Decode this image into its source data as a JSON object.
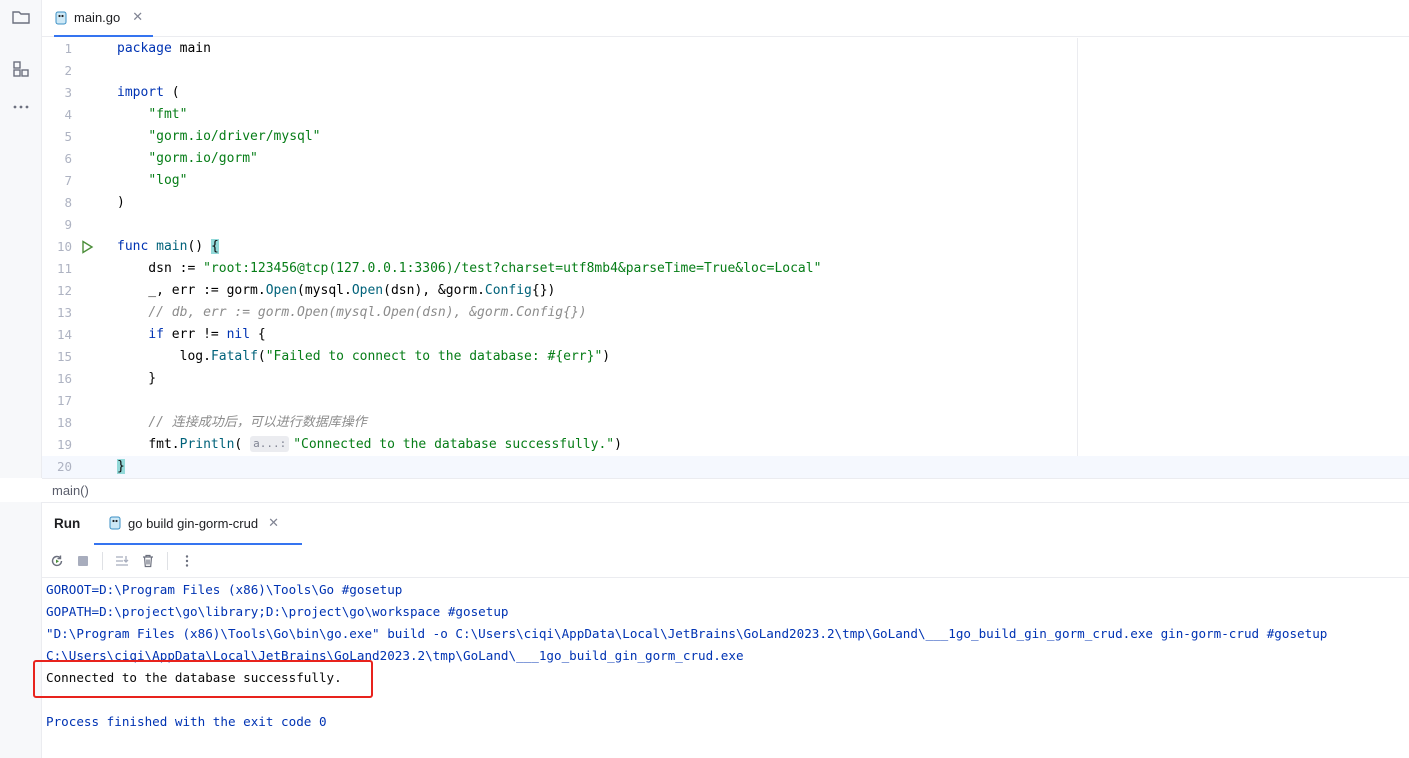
{
  "tabs": [
    {
      "label": "main.go",
      "active": true
    }
  ],
  "editor": {
    "lines": [
      {
        "n": "1",
        "tokens": [
          [
            "kw",
            "package"
          ],
          [
            "pkg",
            " main"
          ]
        ]
      },
      {
        "n": "2",
        "tokens": []
      },
      {
        "n": "3",
        "tokens": [
          [
            "kw",
            "import"
          ],
          [
            "pkg",
            " ("
          ]
        ]
      },
      {
        "n": "4",
        "tokens": [
          [
            "pkg",
            "    "
          ],
          [
            "str",
            "\"fmt\""
          ]
        ]
      },
      {
        "n": "5",
        "tokens": [
          [
            "pkg",
            "    "
          ],
          [
            "str",
            "\"gorm.io/driver/mysql\""
          ]
        ]
      },
      {
        "n": "6",
        "tokens": [
          [
            "pkg",
            "    "
          ],
          [
            "str",
            "\"gorm.io/gorm\""
          ]
        ]
      },
      {
        "n": "7",
        "tokens": [
          [
            "pkg",
            "    "
          ],
          [
            "str",
            "\"log\""
          ]
        ]
      },
      {
        "n": "8",
        "tokens": [
          [
            "pkg",
            ")"
          ]
        ]
      },
      {
        "n": "9",
        "tokens": []
      },
      {
        "n": "10",
        "run": true,
        "tokens": [
          [
            "kw",
            "func"
          ],
          [
            "pkg",
            " "
          ],
          [
            "fn",
            "main"
          ],
          [
            "pkg",
            "() "
          ],
          [
            "hl",
            "{"
          ]
        ]
      },
      {
        "n": "11",
        "tokens": [
          [
            "pkg",
            "    dsn := "
          ],
          [
            "str",
            "\"root:123456@tcp(127.0.0.1:3306)/test?charset=utf8mb4&parseTime=True&loc=Local\""
          ]
        ]
      },
      {
        "n": "12",
        "tokens": [
          [
            "pkg",
            "    _, err := "
          ],
          [
            "pkg",
            "gorm"
          ],
          [
            "pkg",
            "."
          ],
          [
            "fn",
            "Open"
          ],
          [
            "pkg",
            "("
          ],
          [
            "pkg",
            "mysql"
          ],
          [
            "pkg",
            "."
          ],
          [
            "fn",
            "Open"
          ],
          [
            "pkg",
            "(dsn), &"
          ],
          [
            "pkg",
            "gorm"
          ],
          [
            "pkg",
            "."
          ],
          [
            "typ",
            "Config"
          ],
          [
            "pkg",
            "{})"
          ]
        ]
      },
      {
        "n": "13",
        "tokens": [
          [
            "pkg",
            "    "
          ],
          [
            "cm",
            "// db, err := gorm.Open(mysql.Open(dsn), &gorm.Config{})"
          ]
        ]
      },
      {
        "n": "14",
        "tokens": [
          [
            "pkg",
            "    "
          ],
          [
            "kw",
            "if"
          ],
          [
            "pkg",
            " err != "
          ],
          [
            "kw",
            "nil"
          ],
          [
            "pkg",
            " {"
          ]
        ]
      },
      {
        "n": "15",
        "tokens": [
          [
            "pkg",
            "        "
          ],
          [
            "pkg",
            "log"
          ],
          [
            "pkg",
            "."
          ],
          [
            "fn",
            "Fatalf"
          ],
          [
            "pkg",
            "("
          ],
          [
            "str",
            "\"Failed to connect to the database: #{err}\""
          ],
          [
            "pkg",
            ")"
          ]
        ]
      },
      {
        "n": "16",
        "tokens": [
          [
            "pkg",
            "    }"
          ]
        ]
      },
      {
        "n": "17",
        "tokens": []
      },
      {
        "n": "18",
        "tokens": [
          [
            "pkg",
            "    "
          ],
          [
            "cm",
            "// 连接成功后，可以进行数据库操作"
          ]
        ]
      },
      {
        "n": "19",
        "tokens": [
          [
            "pkg",
            "    "
          ],
          [
            "pkg",
            "fmt"
          ],
          [
            "pkg",
            "."
          ],
          [
            "fn",
            "Println"
          ],
          [
            "pkg",
            "( "
          ],
          [
            "hint",
            "a...:"
          ],
          [
            "str",
            "\"Connected to the database successfully.\""
          ],
          [
            "pkg",
            ")"
          ]
        ]
      },
      {
        "n": "20",
        "current": true,
        "tokens": [
          [
            "hl",
            "}"
          ]
        ]
      }
    ]
  },
  "breadcrumb": "main()",
  "run_panel": {
    "title": "Run",
    "tab_label": "go build gin-gorm-crud",
    "console": [
      {
        "text": "GOROOT=D:\\Program Files (x86)\\Tools\\Go #gosetup",
        "kind": "sys"
      },
      {
        "text": "GOPATH=D:\\project\\go\\library;D:\\project\\go\\workspace #gosetup",
        "kind": "sys"
      },
      {
        "text": "\"D:\\Program Files (x86)\\Tools\\Go\\bin\\go.exe\" build -o C:\\Users\\ciqi\\AppData\\Local\\JetBrains\\GoLand2023.2\\tmp\\GoLand\\___1go_build_gin_gorm_crud.exe gin-gorm-crud #gosetup",
        "kind": "sys"
      },
      {
        "text": "C:\\Users\\ciqi\\AppData\\Local\\JetBrains\\GoLand2023.2\\tmp\\GoLand\\___1go_build_gin_gorm_crud.exe",
        "kind": "sys"
      },
      {
        "text": "Connected to the database successfully.",
        "kind": "out"
      },
      {
        "text": "",
        "kind": "sys"
      },
      {
        "text": "Process finished with the exit code 0",
        "kind": "sys"
      }
    ]
  },
  "colors": {
    "accent": "#3574f0",
    "keyword": "#0033b3",
    "string": "#067d17",
    "highlight_box": "#e8231d"
  },
  "icons": [
    "folder-icon",
    "structure-icon",
    "more-icon",
    "go-file-icon",
    "close-icon",
    "run-gutter-icon",
    "rerun-icon",
    "stop-icon",
    "scroll-end-icon",
    "trash-icon",
    "kebab-icon"
  ]
}
